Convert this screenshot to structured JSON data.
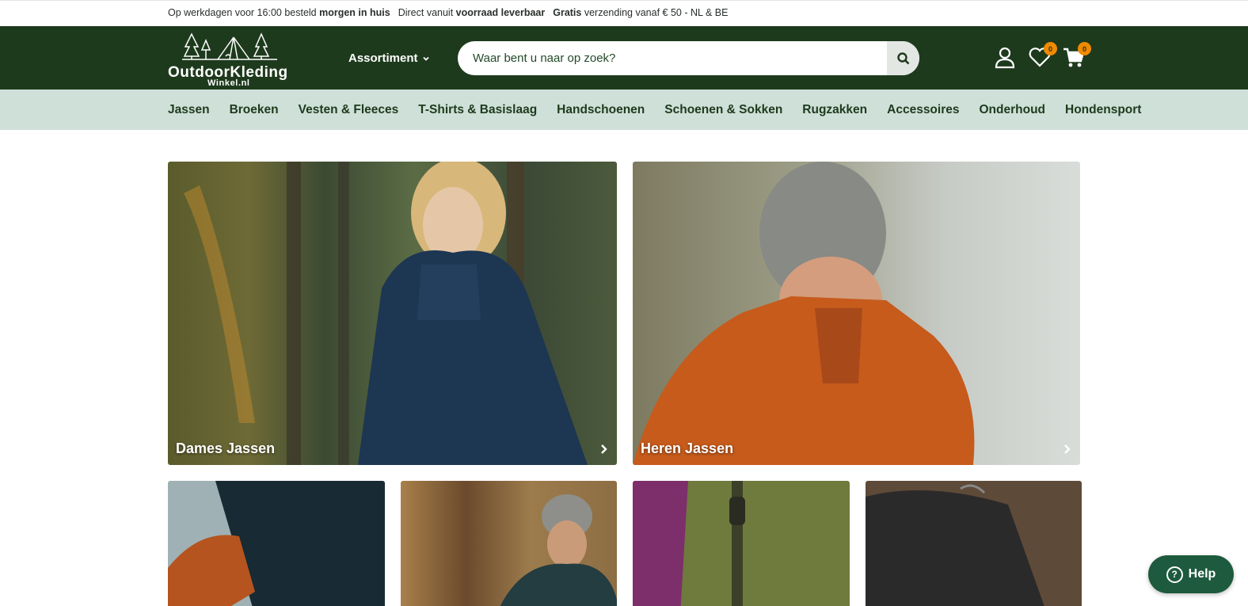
{
  "usp": {
    "item1_pre": "Op werkdagen voor 16:00 besteld",
    "item1_bold": "morgen in huis",
    "item2_pre": "Direct vanuit",
    "item2_bold": "voorraad leverbaar",
    "item3_bold": "Gratis",
    "item3_post": "verzending vanaf € 50 - NL & BE"
  },
  "header": {
    "logo_main": "OutdoorKleding",
    "logo_sub": "Winkel.nl",
    "assortiment_label": "Assortiment",
    "search_placeholder": "Waar bent u naar op zoek?",
    "wishlist_count": "0",
    "cart_count": "0"
  },
  "categories": [
    "Jassen",
    "Broeken",
    "Vesten & Fleeces",
    "T-Shirts & Basislaag",
    "Handschoenen",
    "Schoenen & Sokken",
    "Rugzakken",
    "Accessoires",
    "Onderhoud",
    "Hondensport"
  ],
  "tiles": {
    "dames": "Dames Jassen",
    "heren": "Heren Jassen"
  },
  "help": {
    "label": "Help"
  },
  "colors": {
    "header_bg": "#1e3a1d",
    "nav_bg": "#cfe0d8",
    "badge": "#f18a00",
    "help_bg": "#1e5a3d"
  }
}
